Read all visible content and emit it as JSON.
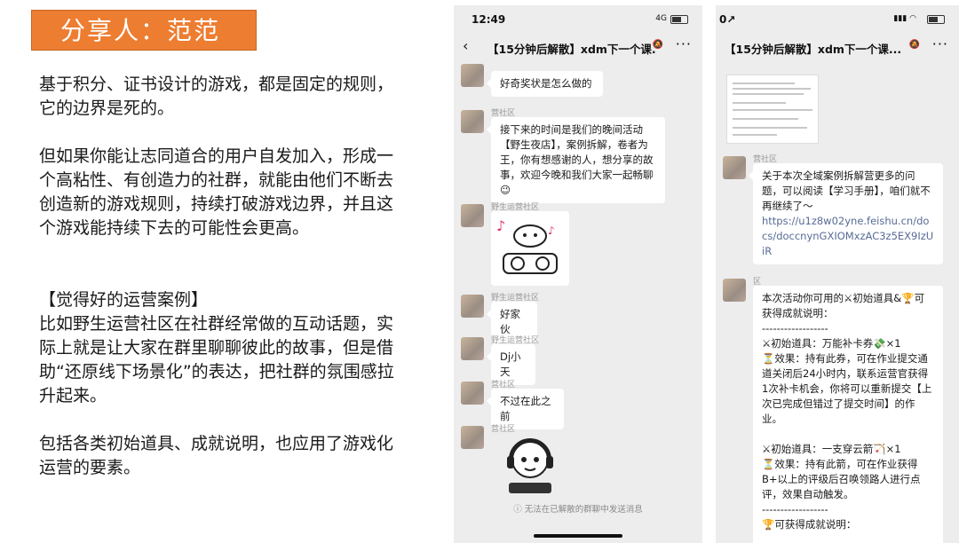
{
  "slide": {
    "sharer_label": "分享人：范范",
    "para1": "基于积分、证书设计的游戏，都是固定的规则，它的边界是死的。",
    "para2": "但如果你能让志同道合的用户自发加入，形成一个高粘性、有创造力的社群，就能由他们不断去创造新的游戏规则，持续打破游戏边界，并且这个游戏能持续下去的可能性会更高。",
    "case_heading": "【觉得好的运营案例】",
    "para3": "比如野生运营社区在社群经常做的互动话题，实际上就是让大家在群里聊聊彼此的故事，但是借助“还原线下场景化”的表达，把社群的氛围感拉升起来。",
    "para4": "包括各类初始道具、成就说明，也应用了游戏化运营的要素。"
  },
  "phone1": {
    "time": "12:49",
    "signal": "4G",
    "chat_title": "【15分钟后解散】xdm下一个课...",
    "back_glyph": "‹",
    "more_glyph": "···",
    "messages": [
      {
        "sender": "",
        "text": "好奇奖状是怎么做的"
      },
      {
        "sender": "营社区",
        "text": "接下来的时间是我们的晚间活动【野生夜店】，案例拆解，卷者为王，你有想感谢的人，想分享的故事，欢迎今晚和我们大家一起畅聊😉"
      },
      {
        "sender": "野生运营社区",
        "text": ""
      },
      {
        "sender": "野生运营社区",
        "text": "好家伙"
      },
      {
        "sender": "野生运营社区",
        "text": "Dj小天"
      },
      {
        "sender": "营社区",
        "text": "不过在此之前"
      },
      {
        "sender": "营社区",
        "text": ""
      }
    ],
    "footer_notice": "无法在已解散的群聊中发送消息"
  },
  "phone2": {
    "time": "0↗",
    "chat_title": "【15分钟后解散】xdm下一个课...",
    "more_glyph": "···",
    "msg1_sender": "营社区",
    "msg1_text": "关于本次全域案例拆解营更多的问题，可以阅读【学习手册】，咱们就不再继续了～",
    "msg1_link": "https://u1z8w02yne.feishu.cn/docs/doccnynGXIOMxzAC3z5EX9IzUiR",
    "msg2_sender": "区",
    "msg2_lines": [
      "本次活动你可用的⚔初始道具&🏆可获得成就说明：",
      "------------------",
      "⚔初始道具：万能补卡券💸×1",
      "⏳效果：持有此券，可在作业提交通道关闭后24小时内，联系运营官获得1次补卡机会，你将可以重新提交【上次已完成但错过了提交时间】的作业。",
      "",
      "⚔初始道具：一支穿云箭🏹×1",
      "⏳效果：持有此箭，可在作业获得B+以上的评级后召唤领路人进行点评，效果自动触发。",
      "------------------",
      "🏆可获得成就说明："
    ]
  },
  "colors": {
    "accent_orange": "#ed7d31",
    "chat_bg": "#ededed",
    "link": "#576b95"
  }
}
